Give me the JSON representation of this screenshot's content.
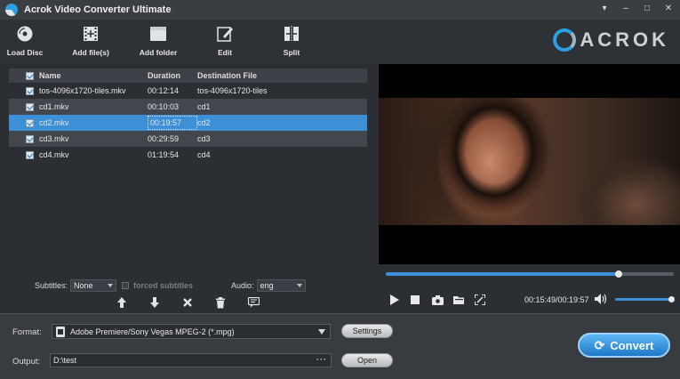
{
  "window": {
    "title": "Acrok Video Converter Ultimate",
    "controls": {
      "menu": "▾",
      "minimize": "–",
      "maximize": "□",
      "close": "✕"
    }
  },
  "toolbar": {
    "load_disc": "Load Disc",
    "add_files": "Add file(s)",
    "add_folder": "Add folder",
    "edit": "Edit",
    "split": "Split",
    "brand": "ACROK"
  },
  "file_list": {
    "columns": {
      "name": "Name",
      "duration": "Duration",
      "destination": "Destination File"
    },
    "rows": [
      {
        "name": "tos-4096x1720-tiles.mkv",
        "duration": "00:12:14",
        "destination": "tos-4096x1720-tiles"
      },
      {
        "name": "cd1.mkv",
        "duration": "00:10:03",
        "destination": "cd1"
      },
      {
        "name": "cd2.mkv",
        "duration": "00:19:57",
        "destination": "cd2"
      },
      {
        "name": "cd3.mkv",
        "duration": "00:29:59",
        "destination": "cd3"
      },
      {
        "name": "cd4.mkv",
        "duration": "01:19:54",
        "destination": "cd4"
      }
    ]
  },
  "subtitles": {
    "label": "Subtitles:",
    "value": "None",
    "forced_label": "forced subtitles"
  },
  "audio": {
    "label": "Audio:",
    "value": "eng"
  },
  "player": {
    "time": "00:15:49/00:19:57",
    "progress": 0.81,
    "volume": 0.95
  },
  "bottom": {
    "format_label": "Format:",
    "format_value": "Adobe Premiere/Sony Vegas MPEG-2 (*.mpg)",
    "settings_label": "Settings",
    "output_label": "Output:",
    "output_value": "D:\\test",
    "browse_label": "···",
    "open_label": "Open",
    "convert_label": "Convert"
  },
  "colors": {
    "accent": "#3d8fd6",
    "background": "#2b2e33",
    "selected_row": "#3d8fd6"
  }
}
